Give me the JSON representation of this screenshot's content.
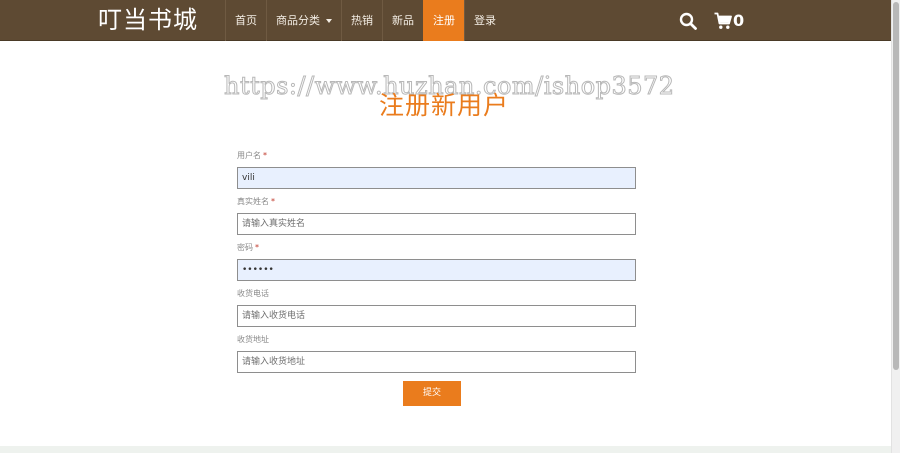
{
  "brand": {
    "title": "叮当书城"
  },
  "nav": {
    "items": [
      {
        "label": "首页",
        "active": false,
        "has_dropdown": false
      },
      {
        "label": "商品分类",
        "active": false,
        "has_dropdown": true
      },
      {
        "label": "热销",
        "active": false,
        "has_dropdown": false
      },
      {
        "label": "新品",
        "active": false,
        "has_dropdown": false
      },
      {
        "label": "注册",
        "active": true,
        "has_dropdown": false
      },
      {
        "label": "登录",
        "active": false,
        "has_dropdown": false
      }
    ],
    "search_icon": "search-icon",
    "cart_icon": "cart-icon",
    "cart_count": "0"
  },
  "watermark": {
    "text": "https://www.huzhan.com/ishop3572"
  },
  "form": {
    "title": "注册新用户",
    "fields": {
      "username": {
        "label": "用户名",
        "required": true,
        "value": "vili",
        "placeholder": ""
      },
      "realname": {
        "label": "真实姓名",
        "required": true,
        "value": "",
        "placeholder": "请输入真实姓名"
      },
      "password": {
        "label": "密码",
        "required": true,
        "value": "••••••",
        "placeholder": ""
      },
      "phone": {
        "label": "收货电话",
        "required": false,
        "value": "",
        "placeholder": "请输入收货电话"
      },
      "address": {
        "label": "收货地址",
        "required": false,
        "value": "",
        "placeholder": "请输入收货地址"
      }
    },
    "required_mark": "*",
    "submit_label": "提交"
  },
  "colors": {
    "navbar": "#5e4a33",
    "accent": "#ea7c1d",
    "autofill": "#e8f0fe"
  }
}
